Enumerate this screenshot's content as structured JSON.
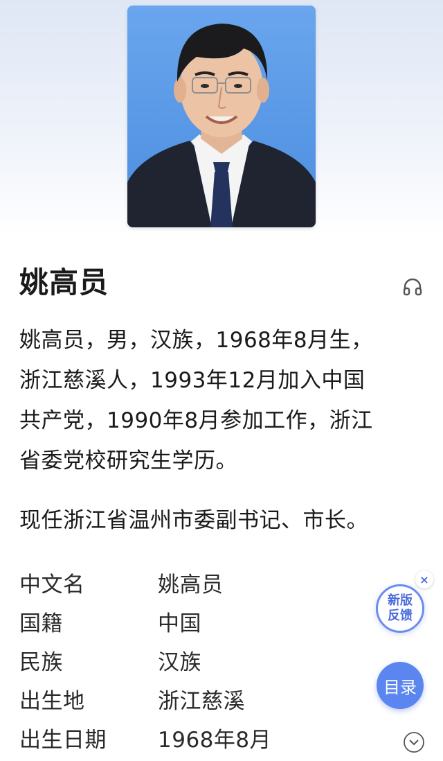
{
  "profile": {
    "name": "姚高员",
    "summary_lines": [
      "姚高员，男，汉族，1968年8月生，",
      "浙江慈溪人，1993年12月加入中国",
      "共产党，1990年8月参加工作，浙江",
      "省委党校研究生学历。"
    ],
    "current_role": "现任浙江省温州市委副书记、市长。"
  },
  "info": [
    {
      "key": "中文名",
      "value": "姚高员"
    },
    {
      "key": "国籍",
      "value": "中国"
    },
    {
      "key": "民族",
      "value": "汉族"
    },
    {
      "key": "出生地",
      "value": "浙江慈溪"
    },
    {
      "key": "出生日期",
      "value": "1968年8月"
    }
  ],
  "floating": {
    "feedback_line1": "新版",
    "feedback_line2": "反馈",
    "close_symbol": "×",
    "toc_label": "目录"
  },
  "icons": {
    "audio": "headphones-icon",
    "close": "close-icon",
    "expand": "chevron-down-icon"
  },
  "colors": {
    "accent": "#5b86ef",
    "portrait_bg": "#5c9ce6"
  }
}
